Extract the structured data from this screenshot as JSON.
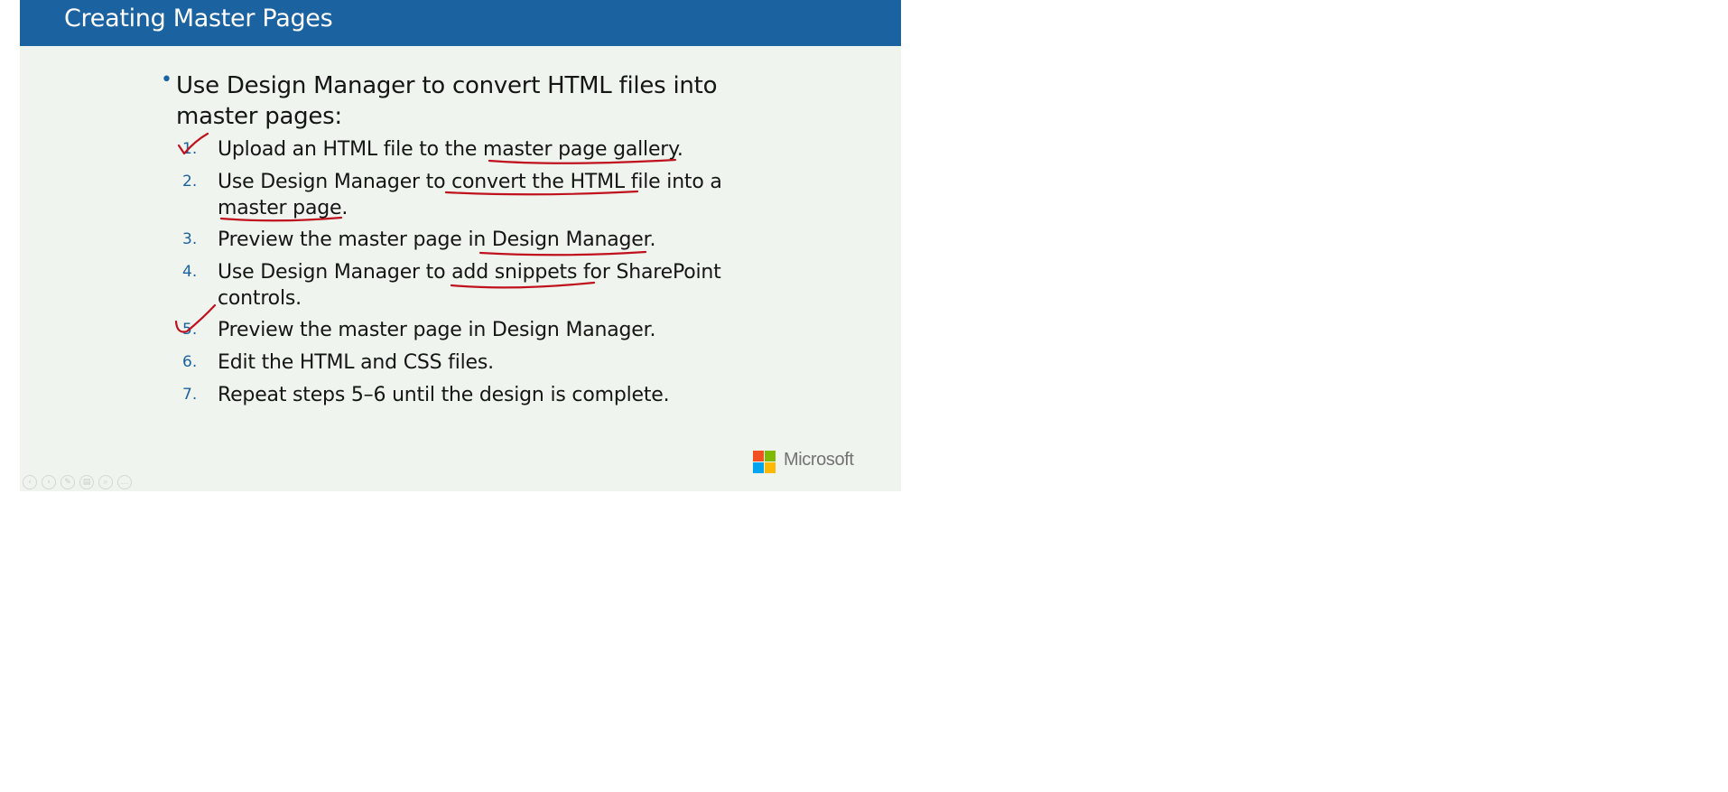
{
  "slide": {
    "title": "Creating Master Pages",
    "bullet": "Use Design Manager to convert HTML files into master pages:",
    "steps": [
      {
        "num": "1.",
        "text": "Upload an HTML file to the master page gallery."
      },
      {
        "num": "2.",
        "text": "Use Design Manager to convert the HTML file into a master page."
      },
      {
        "num": "3.",
        "text": "Preview the master page in Design Manager."
      },
      {
        "num": "4.",
        "text": "Use Design Manager to add snippets for SharePoint controls."
      },
      {
        "num": "5.",
        "text": "Preview the master page in Design Manager."
      },
      {
        "num": "6.",
        "text": "Edit the HTML and CSS files."
      },
      {
        "num": "7.",
        "text": "Repeat steps 5–6 until the design is complete."
      }
    ],
    "brand": "Microsoft"
  },
  "colors": {
    "title_bar": "#1b62a0",
    "background": "#eff4ee",
    "ink": "#c0121e",
    "logo_red": "#f25022",
    "logo_green": "#7fba00",
    "logo_blue": "#00a4ef",
    "logo_yellow": "#ffb900"
  },
  "icons": [
    "previous-slide-icon",
    "next-slide-icon",
    "pen-icon",
    "highlighter-icon",
    "zoom-icon",
    "more-icon"
  ]
}
